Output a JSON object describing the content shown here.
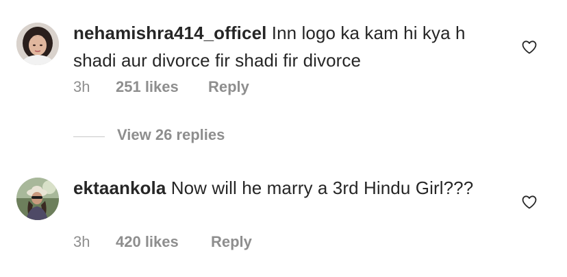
{
  "comments": [
    {
      "username": "nehamishra414_officel",
      "text": "Inn logo ka kam hi kya h shadi aur divorce fir shadi fir divorce",
      "time": "3h",
      "likes": "251 likes",
      "reply_label": "Reply",
      "avatar_icon": "profile-photo-icon",
      "like_icon": "heart-outline-icon"
    },
    {
      "username": "ektaankola",
      "text": "Now  will he marry a 3rd Hindu Girl???",
      "time": "3h",
      "likes": "420 likes",
      "reply_label": "Reply",
      "avatar_icon": "profile-photo-icon",
      "like_icon": "heart-outline-icon"
    }
  ],
  "view_replies": {
    "label": "View 26 replies"
  },
  "colors": {
    "text": "#262626",
    "muted": "#8e8e8e",
    "divider": "#c7c7c7"
  }
}
